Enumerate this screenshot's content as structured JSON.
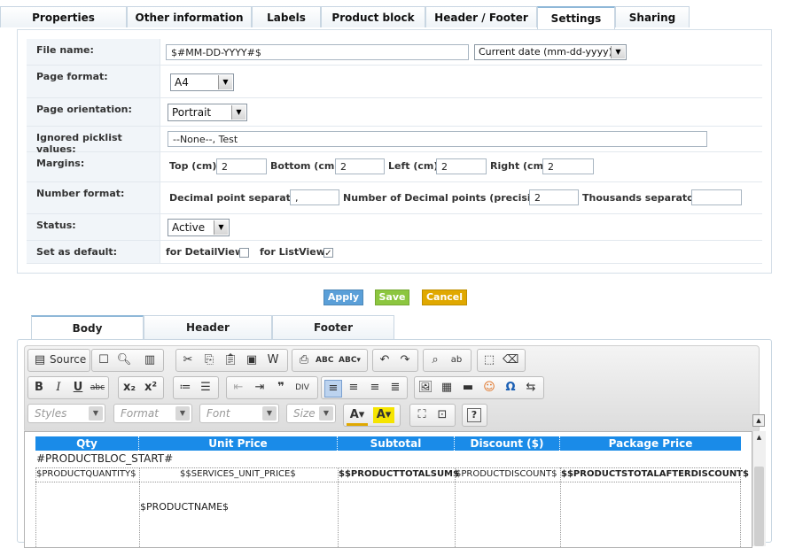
{
  "top_tabs": [
    "Properties",
    "Other information",
    "Labels",
    "Product block",
    "Header / Footer",
    "Settings",
    "Sharing"
  ],
  "settings": {
    "file_name_label": "File name:",
    "file_name_value": "$#MM-DD-YYYY#$",
    "file_name_select": "Current date (mm-dd-yyyy)",
    "page_format_label": "Page format:",
    "page_format_value": "A4",
    "page_orientation_label": "Page orientation:",
    "page_orientation_value": "Portrait",
    "ignored_label": "Ignored picklist values:",
    "ignored_value": "--None--, Test",
    "margins_label": "Margins:",
    "margin_top_label": "Top (cm)",
    "margin_top_value": "2",
    "margin_bottom_label": "Bottom (cm)",
    "margin_bottom_value": "2",
    "margin_left_label": "Left (cm)",
    "margin_left_value": "2",
    "margin_right_label": "Right (cm)",
    "margin_right_value": "2",
    "number_format_label": "Number format:",
    "decimal_sep_label": "Decimal point separator",
    "decimal_sep_value": ",",
    "decimal_points_label": "Number of Decimal points (precision)",
    "decimal_points_value": "2",
    "thousands_label": "Thousands separator",
    "thousands_value": "",
    "status_label": "Status:",
    "status_value": "Active",
    "default_label": "Set as default:",
    "detailview_label": "for DetailView",
    "listview_label": "for ListView",
    "detailview_checked": false,
    "listview_checked": true
  },
  "buttons": {
    "apply": "Apply",
    "save": "Save",
    "cancel": "Cancel",
    "apply_color": "#5a9fd8",
    "save_color": "#8cc63f",
    "cancel_color": "#e0a800"
  },
  "body_tabs": [
    "Body",
    "Header",
    "Footer"
  ],
  "editor": {
    "source_label": "Source",
    "styles_placeholder": "Styles",
    "format_placeholder": "Format",
    "font_placeholder": "Font",
    "size_placeholder": "Size",
    "table_headers": [
      "Qty",
      "Unit Price",
      "Subtotal",
      "Discount ($)",
      "Package Price"
    ],
    "bloc_start": "#PRODUCTBLOC_START#",
    "row": [
      "$PRODUCTQUANTITY$",
      "$$SERVICES_UNIT_PRICE$",
      "$$PRODUCTTOTALSUM$",
      "$PRODUCTDISCOUNT$",
      "$$PRODUCTSTOTALAFTERDISCOUNT$"
    ],
    "product_name": "$PRODUCTNAME$"
  }
}
